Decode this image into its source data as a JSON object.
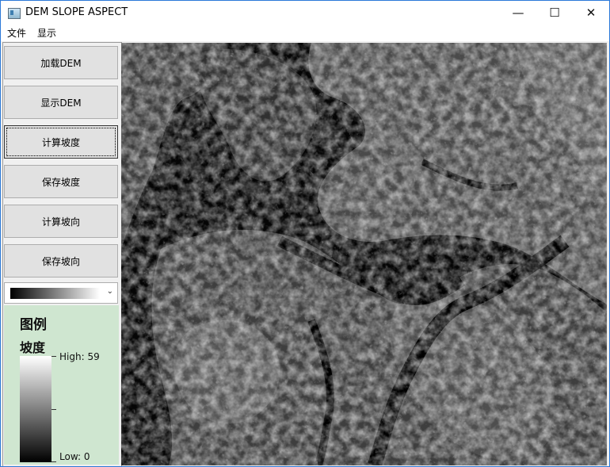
{
  "window": {
    "title": "DEM SLOPE ASPECT",
    "minimize_glyph": "—",
    "maximize_glyph": "☐",
    "close_glyph": "✕"
  },
  "menu": [
    "文件",
    "显示"
  ],
  "buttons": {
    "load_dem": "加载DEM",
    "show_dem": "显示DEM",
    "calc_slope": "计算坡度",
    "save_slope": "保存坡度",
    "calc_aspect": "计算坡向",
    "save_aspect": "保存坡向"
  },
  "color_ramp": {
    "selected": "black-to-white",
    "start": "#000000",
    "end": "#ffffff",
    "arrow": "⌄"
  },
  "legend": {
    "title": "图例",
    "layer": "坡度",
    "high_label": "High:  59",
    "low_label": "Low:  0"
  },
  "map": {
    "content": "slope raster (grayscale)"
  }
}
